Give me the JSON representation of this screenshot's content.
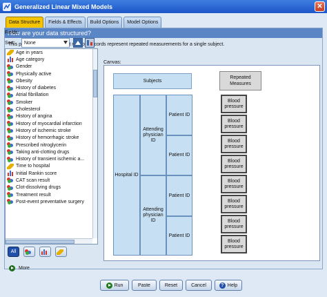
{
  "window": {
    "title": "Generalized Linear Mixed Models"
  },
  "tabs": [
    {
      "label": "Data Structure",
      "active": true
    },
    {
      "label": "Fields & Effects",
      "active": false
    },
    {
      "label": "Build Options",
      "active": false
    },
    {
      "label": "Model Options",
      "active": false
    }
  ],
  "section": {
    "question": "How are your data structured?",
    "description": "This procedure assumes that multiple records represent repeated measurements for a single subject."
  },
  "fields_panel": {
    "label": "Fields:",
    "sort_label": "Sort:",
    "sort_value": "None",
    "items": [
      {
        "label": "Age in years",
        "icon": "scale-icon"
      },
      {
        "label": "Age category",
        "icon": "ordinal-icon"
      },
      {
        "label": "Gender",
        "icon": "nominal-icon"
      },
      {
        "label": "Physically active",
        "icon": "nominal-icon"
      },
      {
        "label": "Obesity",
        "icon": "nominal-icon"
      },
      {
        "label": "History of diabetes",
        "icon": "nominal-icon"
      },
      {
        "label": "Atrial fibrillation",
        "icon": "nominal-icon"
      },
      {
        "label": "Smoker",
        "icon": "nominal-icon"
      },
      {
        "label": "Cholesterol",
        "icon": "nominal-icon"
      },
      {
        "label": "History of angina",
        "icon": "nominal-icon"
      },
      {
        "label": "History of myocardial infarction",
        "icon": "nominal-icon"
      },
      {
        "label": "History of ischemic stroke",
        "icon": "nominal-icon"
      },
      {
        "label": "History of hemorrhagic stroke",
        "icon": "nominal-icon"
      },
      {
        "label": "Prescribed nitroglycerin",
        "icon": "nominal-icon"
      },
      {
        "label": "Taking anti-clotting drugs",
        "icon": "nominal-icon"
      },
      {
        "label": "History of transient ischemic a...",
        "icon": "nominal-icon"
      },
      {
        "label": "Time to hospital",
        "icon": "scale-icon"
      },
      {
        "label": "Initial Rankin score",
        "icon": "ordinal-icon"
      },
      {
        "label": "CAT scan result",
        "icon": "nominal-icon"
      },
      {
        "label": "Clot-dissolving drugs",
        "icon": "nominal-icon"
      },
      {
        "label": "Treatment result",
        "icon": "nominal-icon"
      },
      {
        "label": "Post-event preventative surgery",
        "icon": "nominal-icon"
      }
    ],
    "filter_buttons": [
      {
        "label": "All",
        "icon": "all-icon"
      },
      {
        "label": "",
        "icon": "nominal-filter-icon"
      },
      {
        "label": "",
        "icon": "ordinal-filter-icon"
      },
      {
        "label": "",
        "icon": "scale-filter-icon"
      }
    ]
  },
  "canvas": {
    "label": "Canvas:",
    "subjects_header": "Subjects",
    "repeated_header": "Repeated Measures",
    "level1": "Hospital ID",
    "level2": [
      "Attending physician ID",
      "Attending physician ID"
    ],
    "level3": [
      "Patient ID",
      "Patient ID",
      "Patient ID",
      "Patient ID"
    ],
    "repeated_items": [
      "Blood pressure",
      "Blood pressure",
      "Blood pressure",
      "Blood pressure",
      "Blood pressure",
      "Blood pressure",
      "Blood pressure",
      "Blood pressure"
    ]
  },
  "more": {
    "label": "More"
  },
  "footer": {
    "run": "Run",
    "paste": "Paste",
    "reset": "Reset",
    "cancel": "Cancel",
    "help": "Help"
  }
}
